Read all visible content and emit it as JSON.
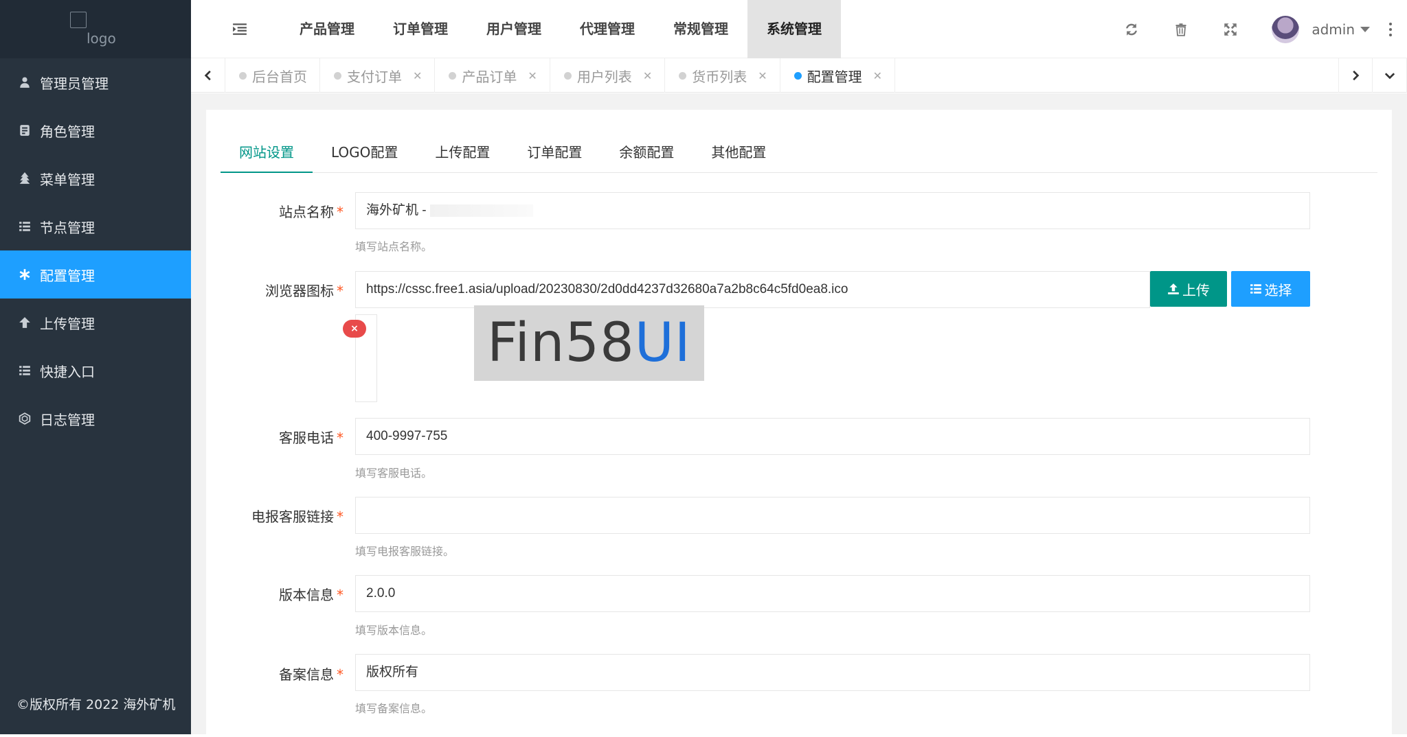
{
  "logo": {
    "alt": "logo"
  },
  "sidebar": {
    "items": [
      {
        "label": "管理员管理",
        "icon": "user-icon"
      },
      {
        "label": "角色管理",
        "icon": "role-icon"
      },
      {
        "label": "菜单管理",
        "icon": "tree-icon"
      },
      {
        "label": "节点管理",
        "icon": "list-icon"
      },
      {
        "label": "配置管理",
        "icon": "asterisk-icon",
        "active": true
      },
      {
        "label": "上传管理",
        "icon": "arrow-up-icon"
      },
      {
        "label": "快捷入口",
        "icon": "list-icon"
      },
      {
        "label": "日志管理",
        "icon": "log-icon"
      }
    ],
    "copyright": "©版权所有 2022 海外矿机"
  },
  "header": {
    "nav": [
      "产品管理",
      "订单管理",
      "用户管理",
      "代理管理",
      "常规管理",
      "系统管理"
    ],
    "active_nav": "系统管理",
    "username": "admin"
  },
  "tabs": [
    {
      "label": "后台首页",
      "closable": false
    },
    {
      "label": "支付订单",
      "closable": true
    },
    {
      "label": "产品订单",
      "closable": true
    },
    {
      "label": "用户列表",
      "closable": true
    },
    {
      "label": "货币列表",
      "closable": true
    },
    {
      "label": "配置管理",
      "closable": true,
      "active": true
    }
  ],
  "subtabs": [
    "网站设置",
    "LOGO配置",
    "上传配置",
    "订单配置",
    "余额配置",
    "其他配置"
  ],
  "form": {
    "site_name": {
      "label": "站点名称",
      "value": "海外矿机 - ",
      "hint": "填写站点名称。"
    },
    "favicon": {
      "label": "浏览器图标",
      "value": "https://cssc.free1.asia/upload/20230830/2d0dd4237d32680a7a2b8c64c5fd0ea8.ico",
      "upload": "上传",
      "choose": "选择",
      "delete": "×"
    },
    "phone": {
      "label": "客服电话",
      "value": "400-9997-755",
      "hint": "填写客服电话。"
    },
    "telegram": {
      "label": "电报客服链接",
      "value": "",
      "hint": "填写电报客服链接。"
    },
    "version": {
      "label": "版本信息",
      "value": "2.0.0",
      "hint": "填写版本信息。"
    },
    "record": {
      "label": "备案信息",
      "value": "版权所有",
      "hint": "填写备案信息。"
    }
  },
  "watermark": {
    "text": "Fin58",
    "accent": "UI"
  },
  "colors": {
    "sidebar": "#28333e",
    "active": "#1e9fff",
    "primary": "#009688",
    "required": "#ff5722"
  }
}
